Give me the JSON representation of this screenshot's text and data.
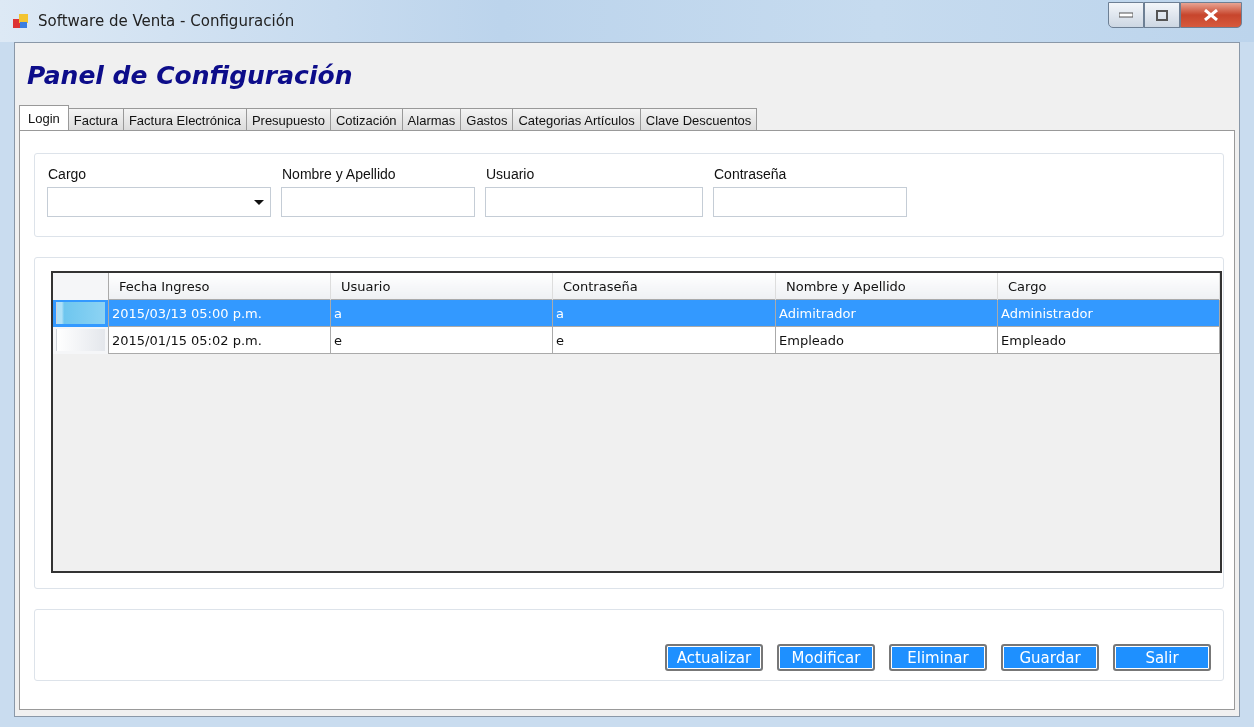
{
  "window": {
    "title": "Software de Venta - Configuración"
  },
  "heading": "Panel de Configuración",
  "tabs": [
    {
      "label": "Login",
      "selected": true
    },
    {
      "label": "Factura",
      "selected": false
    },
    {
      "label": "Factura Electrónica",
      "selected": false
    },
    {
      "label": "Presupuesto",
      "selected": false
    },
    {
      "label": "Cotización",
      "selected": false
    },
    {
      "label": "Alarmas",
      "selected": false
    },
    {
      "label": "Gastos",
      "selected": false
    },
    {
      "label": "Categorias Artículos",
      "selected": false
    },
    {
      "label": "Clave Descuentos",
      "selected": false
    }
  ],
  "form_fields": [
    {
      "label": "Cargo",
      "kind": "dropdown"
    },
    {
      "label": "Nombre y Apellido",
      "kind": "text"
    },
    {
      "label": "Usuario",
      "kind": "text"
    },
    {
      "label": "Contraseña",
      "kind": "text"
    }
  ],
  "table": {
    "columns": [
      "Fecha Ingreso",
      "Usuario",
      "Contraseña",
      "Nombre y Apellido",
      "Cargo"
    ],
    "rows": [
      {
        "cells": [
          "2015/03/13 05:00 p.m.",
          "a",
          "a",
          "Adimitrador",
          "Administrador"
        ],
        "selected": true
      },
      {
        "cells": [
          "2015/01/15 05:02 p.m.",
          "e",
          "e",
          "Empleado",
          "Empleado"
        ],
        "selected": false
      }
    ]
  },
  "buttons": [
    "Actualizar",
    "Modificar",
    "Eliminar",
    "Guardar",
    "Salir"
  ]
}
